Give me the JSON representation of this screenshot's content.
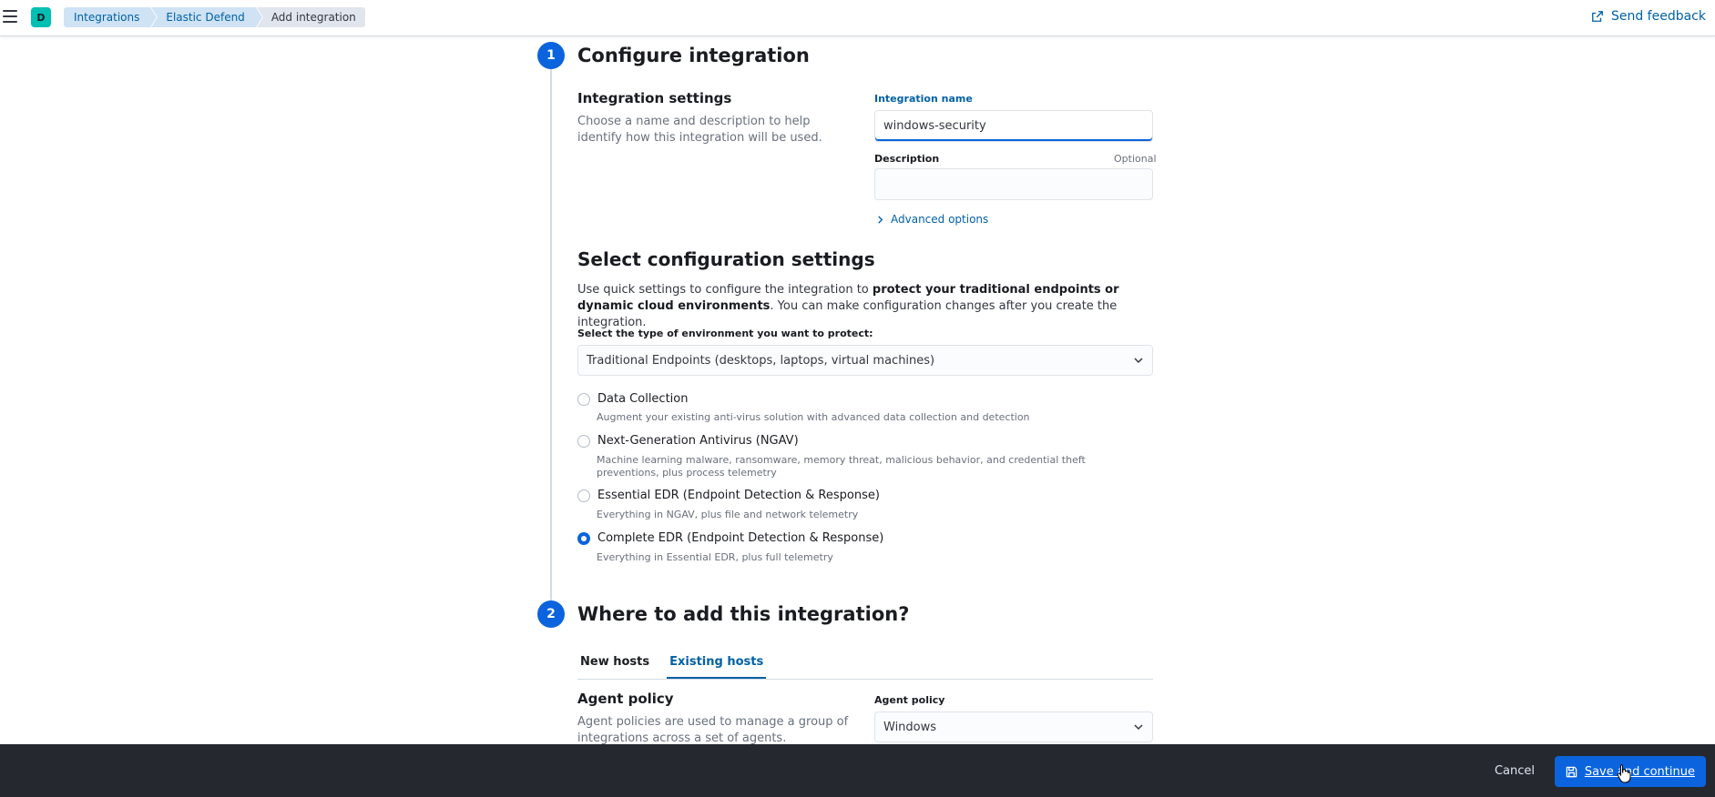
{
  "header": {
    "space_initial": "D",
    "breadcrumbs": [
      "Integrations",
      "Elastic Defend",
      "Add integration"
    ],
    "feedback_label": "Send feedback"
  },
  "step1": {
    "number": "1",
    "title": "Configure integration",
    "settings_heading": "Integration settings",
    "settings_desc": "Choose a name and description to help identify how this integration will be used.",
    "name_label": "Integration name",
    "name_value": "windows-security",
    "desc_label": "Description",
    "desc_optional": "Optional",
    "desc_value": "",
    "advanced_label": "Advanced options",
    "config_heading": "Select configuration settings",
    "config_para_1": "Use quick settings to configure the integration to ",
    "config_para_bold": "protect your traditional endpoints or dynamic cloud environments",
    "config_para_2": ". You can make configuration changes after you create the integration.",
    "env_label": "Select the type of environment you want to protect:",
    "env_value": "Traditional Endpoints (desktops, laptops, virtual machines)",
    "options": [
      {
        "label": "Data Collection",
        "desc": "Augment your existing anti-virus solution with advanced data collection and detection",
        "checked": false
      },
      {
        "label": "Next-Generation Antivirus (NGAV)",
        "desc": "Machine learning malware, ransomware, memory threat, malicious behavior, and credential theft preventions, plus process telemetry",
        "checked": false
      },
      {
        "label": "Essential EDR (Endpoint Detection & Response)",
        "desc": "Everything in NGAV, plus file and network telemetry",
        "checked": false
      },
      {
        "label": "Complete EDR (Endpoint Detection & Response)",
        "desc": "Everything in Essential EDR, plus full telemetry",
        "checked": true
      }
    ]
  },
  "step2": {
    "number": "2",
    "title": "Where to add this integration?",
    "tabs": [
      "New hosts",
      "Existing hosts"
    ],
    "active_tab": "Existing hosts",
    "policy_heading": "Agent policy",
    "policy_desc": "Agent policies are used to manage a group of integrations across a set of agents.",
    "policy_label": "Agent policy",
    "policy_value": "Windows"
  },
  "footer": {
    "cancel_label": "Cancel",
    "save_label": "Save and continue"
  },
  "colors": {
    "accent": "#0b64dd",
    "link": "#0061a6",
    "footer_bg": "#25282f",
    "space_avatar": "#00bfb3"
  }
}
